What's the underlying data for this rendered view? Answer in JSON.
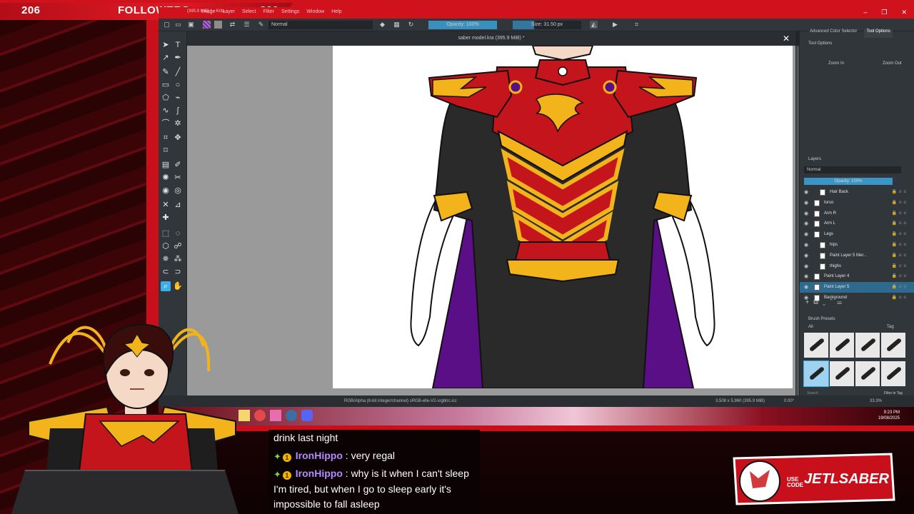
{
  "overlay": {
    "followers_current": "206",
    "followers_label": "FOLLOWERS",
    "followers_goal": "300",
    "sponsor_code_prefix": "USE CODE",
    "sponsor_code": "JETLSABER"
  },
  "window": {
    "title": "(395.9 MiB) * - Krita",
    "menu": [
      "Image",
      "Layer",
      "Select",
      "Filter",
      "Settings",
      "Window",
      "Help"
    ],
    "controls": [
      "–",
      "❐",
      "✕"
    ]
  },
  "toolbar": {
    "blend_mode": "Normal",
    "opacity": "Opacity: 100%",
    "size": "Size: 31.50 px"
  },
  "document": {
    "tab_title": "saber model.kra (395.9 MiB) *",
    "close": "✕"
  },
  "statusbar": {
    "color_profile": "RGB/Alpha (8-bit integer/channel)  sRGB-elle-V2-srgbtrc.icc",
    "dimensions": "3,508 x 5,960 (395.9 MiB)",
    "rotation": "0.00°",
    "zoom": "33.3%"
  },
  "dockers": {
    "tabs": [
      "Advanced Color Selector",
      "Tool Options"
    ],
    "active_tab": "Tool Options",
    "tool_options_title": "Tool Options",
    "zoom_in": "Zoom In",
    "zoom_out": "Zoom Out",
    "layers_title": "Layers",
    "layers_blend": "Normal",
    "layers_opacity": "Opacity: 100%",
    "layers": [
      {
        "name": "Hair Back",
        "indent": 2,
        "selected": false
      },
      {
        "name": "torso",
        "indent": 1,
        "selected": false
      },
      {
        "name": "Arm R",
        "indent": 1,
        "selected": false
      },
      {
        "name": "Arm L",
        "indent": 1,
        "selected": false
      },
      {
        "name": "Legs",
        "indent": 1,
        "selected": false
      },
      {
        "name": "hips",
        "indent": 2,
        "selected": false
      },
      {
        "name": "Paint Layer 5 Mer...",
        "indent": 2,
        "selected": false
      },
      {
        "name": "thighs",
        "indent": 2,
        "selected": false
      },
      {
        "name": "Paint Layer 4",
        "indent": 1,
        "selected": false
      },
      {
        "name": "Paint Layer 5",
        "indent": 1,
        "selected": true
      },
      {
        "name": "Background",
        "indent": 1,
        "selected": false
      }
    ],
    "brush_presets_title": "Brush Presets",
    "brush_filter": "All",
    "brush_tag": "Tag",
    "brush_search": "Search",
    "filter_in_tag": "Filter in Tag"
  },
  "tray": {
    "time": "9:23 PM",
    "date": "19/08/2025"
  },
  "chat": [
    {
      "user": "",
      "text": "drink last night"
    },
    {
      "user": "IronHippo",
      "text": ": very regal"
    },
    {
      "user": "IronHippo",
      "text": ": why is it when I can't sleep"
    },
    {
      "user": "",
      "text": "I'm tired, but when I go to sleep early it's"
    },
    {
      "user": "",
      "text": "impossible to fall asleep"
    }
  ],
  "colors": {
    "accent_red": "#d0121d",
    "krita_bg": "#31363b",
    "krita_highlight": "#3daee9",
    "armor_red": "#c4141c",
    "armor_gold": "#f2b31b",
    "cape_purple": "#5b0f86"
  }
}
